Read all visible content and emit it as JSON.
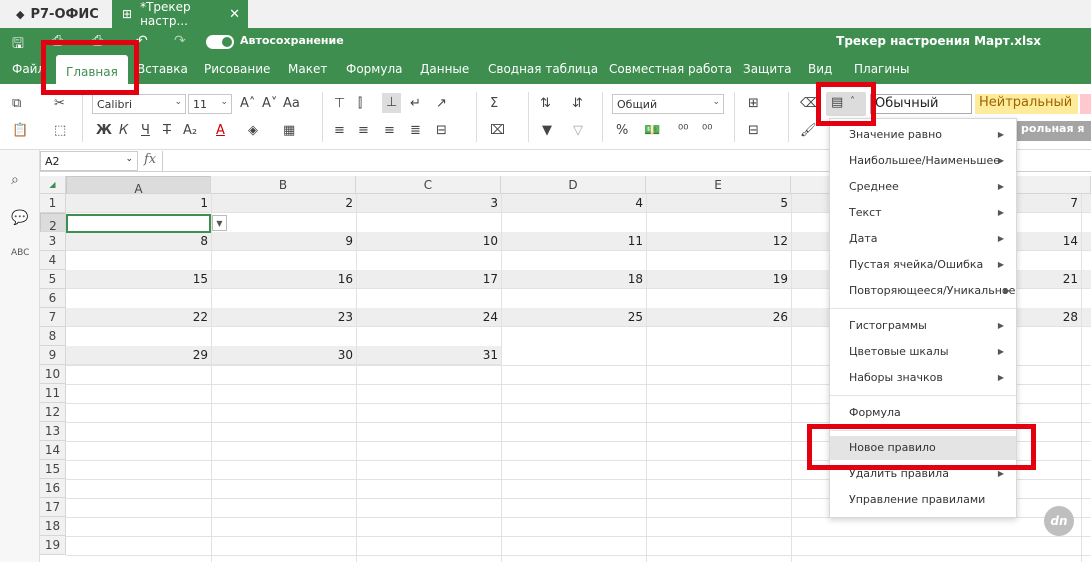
{
  "app": {
    "brand": "Р7-ОФИС",
    "doc_tab": "*Трекер настр...",
    "doc_title": "Трекер настроения Март.xlsx",
    "autosave_label": "Автосохранение"
  },
  "menu_tabs": [
    "Файл",
    "Главная",
    "Вставка",
    "Рисование",
    "Макет",
    "Формула",
    "Данные",
    "Сводная таблица",
    "Совместная работа",
    "Защита",
    "Вид",
    "Плагины"
  ],
  "active_tab": "Главная",
  "toolbar": {
    "font_name": "Calibri",
    "font_size": "11",
    "number_format": "Общий",
    "styles": [
      "Обычный",
      "Нейтральный",
      "рольная я"
    ]
  },
  "formula_bar": {
    "name_box": "A2",
    "fx": "fx",
    "value": ""
  },
  "grid": {
    "columns": [
      "A",
      "B",
      "C",
      "D",
      "E"
    ],
    "rows": [
      "1",
      "2",
      "3",
      "4",
      "5",
      "6",
      "7",
      "8",
      "9",
      "10",
      "11",
      "12",
      "13",
      "14",
      "15",
      "16",
      "17",
      "18",
      "19"
    ],
    "values": {
      "row1": [
        "1",
        "2",
        "3",
        "4",
        "5",
        "7"
      ],
      "row3": [
        "8",
        "9",
        "10",
        "11",
        "12",
        "14"
      ],
      "row5": [
        "15",
        "16",
        "17",
        "18",
        "19",
        "21"
      ],
      "row7": [
        "22",
        "23",
        "24",
        "25",
        "26",
        "28"
      ],
      "row9": [
        "29",
        "30",
        "31"
      ]
    }
  },
  "cf_menu": {
    "items": [
      {
        "label": "Значение равно",
        "sub": true
      },
      {
        "label": "Наибольшее/Наименьшее",
        "sub": true
      },
      {
        "label": "Среднее",
        "sub": true
      },
      {
        "label": "Текст",
        "sub": true
      },
      {
        "label": "Дата",
        "sub": true
      },
      {
        "label": "Пустая ячейка/Ошибка",
        "sub": true
      },
      {
        "label": "Повторяющееся/Уникальное",
        "sub": true
      },
      {
        "label": "Гистограммы",
        "sub": true
      },
      {
        "label": "Цветовые шкалы",
        "sub": true
      },
      {
        "label": "Наборы значков",
        "sub": true
      },
      {
        "label": "Формула",
        "sub": false
      },
      {
        "label": "Новое правило",
        "sub": false
      },
      {
        "label": "Удалить правила",
        "sub": true
      },
      {
        "label": "Управление правилами",
        "sub": false
      }
    ],
    "highlighted": "Новое правило"
  },
  "colors": {
    "green": "#3d8e4f",
    "highlight_red": "#e3000f"
  },
  "watermark": "dn"
}
